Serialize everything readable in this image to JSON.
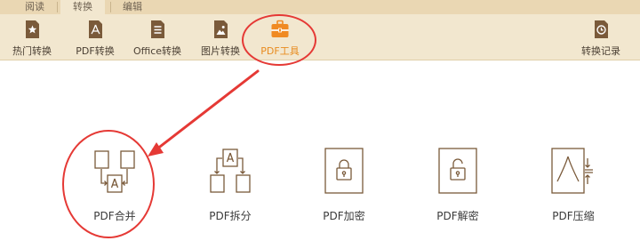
{
  "tabs": [
    {
      "label": "阅读"
    },
    {
      "label": "转换"
    },
    {
      "label": "编辑"
    }
  ],
  "toolbar": {
    "items": [
      {
        "label": "热门转换",
        "icon": "star-icon"
      },
      {
        "label": "PDF转换",
        "icon": "pdf-convert-icon"
      },
      {
        "label": "Office转换",
        "icon": "office-doc-icon"
      },
      {
        "label": "图片转换",
        "icon": "image-icon"
      },
      {
        "label": "PDF工具",
        "icon": "toolbox-icon"
      }
    ],
    "history": {
      "label": "转换记录",
      "icon": "clock-icon"
    }
  },
  "features": [
    {
      "label": "PDF合并",
      "icon": "pdf-merge-icon"
    },
    {
      "label": "PDF拆分",
      "icon": "pdf-split-icon"
    },
    {
      "label": "PDF加密",
      "icon": "lock-icon"
    },
    {
      "label": "PDF解密",
      "icon": "unlock-icon"
    },
    {
      "label": "PDF压缩",
      "icon": "compress-icon"
    }
  ],
  "colors": {
    "accent": "#e88b1f",
    "annotation": "#e53935",
    "toolbar_bg": "#f2e7cf",
    "icon_brown": "#7a5a3a"
  }
}
